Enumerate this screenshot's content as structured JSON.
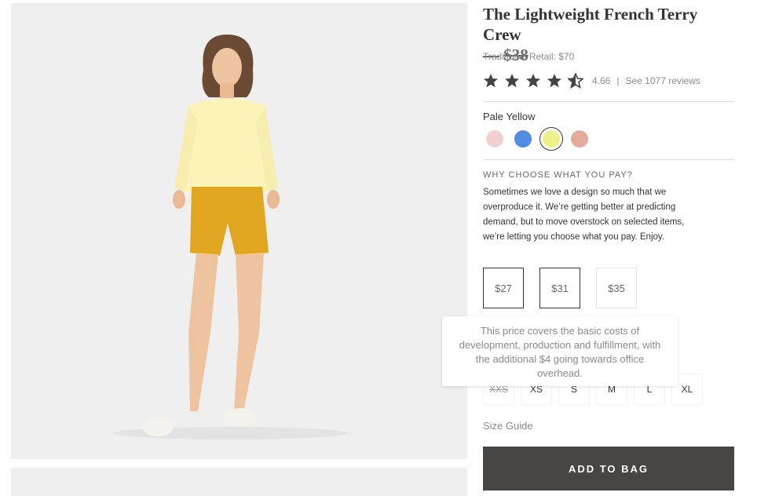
{
  "product": {
    "name": "The Lightweight French Terry Crew",
    "dash": "—",
    "original_price": "$38",
    "traditional_retail": "Traditional Retail: $70"
  },
  "rating": {
    "value": 4.66,
    "value_text": "4.66",
    "separator": "|",
    "reviews_link": "See 1077 reviews",
    "star_color": "#444444"
  },
  "color": {
    "selected_label": "Pale Yellow",
    "swatches": [
      {
        "name": "light-pink",
        "hex": "#f2d0d0"
      },
      {
        "name": "blue",
        "hex": "#4f8de3"
      },
      {
        "name": "pale-yellow",
        "hex": "#eef08a"
      },
      {
        "name": "dusty-rose",
        "hex": "#e2ab9c"
      }
    ]
  },
  "pricing": {
    "heading": "WHY CHOOSE WHAT YOU PAY?",
    "body": "Sometimes we love a design so much that we overproduce it. We’re getting better at predicting demand, but to move overstock on selected items, we’re letting you choose what you pay. Enjoy.",
    "options": [
      "$27",
      "$31",
      "$35"
    ],
    "tooltip": "This price covers the basic costs of development, production and fulfillment, with the additional $4 going towards office overhead."
  },
  "sizes": {
    "options": [
      "XXS",
      "XS",
      "S",
      "M",
      "L",
      "XL"
    ],
    "guide_link": "Size Guide"
  },
  "cta": {
    "add_to_bag": "ADD TO BAG"
  },
  "colors": {
    "button_bg": "#474645",
    "photo_bg": "#efeff0"
  }
}
